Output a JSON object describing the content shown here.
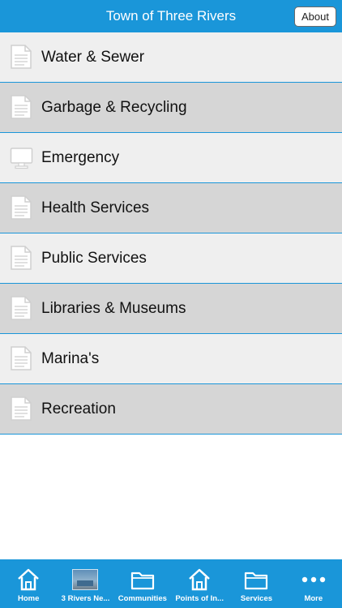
{
  "header": {
    "title": "Town of Three Rivers",
    "about_label": "About"
  },
  "menu": {
    "items": [
      {
        "label": "Water & Sewer",
        "icon": "document-icon"
      },
      {
        "label": "Garbage & Recycling",
        "icon": "document-icon"
      },
      {
        "label": "Emergency",
        "icon": "monitor-icon"
      },
      {
        "label": "Health Services",
        "icon": "document-icon"
      },
      {
        "label": "Public Services",
        "icon": "document-icon"
      },
      {
        "label": "Libraries & Museums",
        "icon": "document-icon"
      },
      {
        "label": "Marina's",
        "icon": "document-icon"
      },
      {
        "label": "Recreation",
        "icon": "document-icon"
      }
    ]
  },
  "tabbar": {
    "tabs": [
      {
        "label": "Home",
        "icon": "house-icon"
      },
      {
        "label": "3 Rivers Ne...",
        "icon": "thumbnail-image"
      },
      {
        "label": "Communities",
        "icon": "folder-icon"
      },
      {
        "label": "Points of In...",
        "icon": "house-icon"
      },
      {
        "label": "Services",
        "icon": "folder-icon"
      },
      {
        "label": "More",
        "icon": "more-icon"
      }
    ]
  },
  "colors": {
    "accent": "#1a96d9",
    "row_light": "#efefef",
    "row_dark": "#d6d6d6"
  }
}
